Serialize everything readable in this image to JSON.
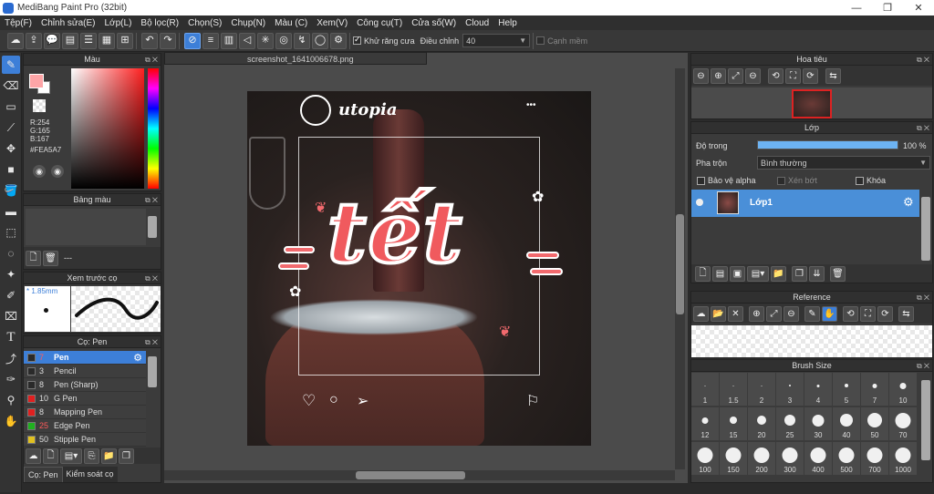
{
  "window": {
    "title": "MediBang Paint Pro (32bit)"
  },
  "menu": [
    "Tệp(F)",
    "Chỉnh sửa(E)",
    "Lớp(L)",
    "Bộ lọc(R)",
    "Chọn(S)",
    "Chụp(N)",
    "Màu (C)",
    "Xem(V)",
    "Công cụ(T)",
    "Cửa số(W)",
    "Cloud",
    "Help"
  ],
  "toolbar": {
    "antialias_label": "Khử răng cưa",
    "adjust_label": "Điều chỉnh",
    "adjust_value": "40",
    "smooth_label": "Cạnh mềm"
  },
  "color_panel": {
    "title": "Màu",
    "r": "R:254",
    "g": "G:165",
    "b": "B:167",
    "hex": "#FEA5A7",
    "current": "#fea5a7"
  },
  "palette_panel": {
    "title": "Bảng màu",
    "footer": "---"
  },
  "brush_preview": {
    "title": "Xem trước cọ",
    "size": "* 1.85mm"
  },
  "brush_panel": {
    "title": "Cọ: Pen",
    "items": [
      {
        "size": "7",
        "name": "Pen",
        "color": "#2a2a2a"
      },
      {
        "size": "3",
        "name": "Pencil",
        "color": "#2a2a2a"
      },
      {
        "size": "8",
        "name": "Pen (Sharp)",
        "color": "#2a2a2a"
      },
      {
        "size": "10",
        "name": "G Pen",
        "color": "#e02020"
      },
      {
        "size": "8",
        "name": "Mapping Pen",
        "color": "#e02020"
      },
      {
        "size": "25",
        "name": "Edge Pen",
        "color": "#20b020"
      },
      {
        "size": "50",
        "name": "Stipple Pen",
        "color": "#e0c020"
      }
    ],
    "tab1": "Cọ: Pen",
    "tab2": "Kiểm soát cọ"
  },
  "document": {
    "tab": "screenshot_1641006678.png"
  },
  "artwork": {
    "brand": "utopia",
    "word": "tết",
    "menu": "•••"
  },
  "navigator": {
    "title": "Hoa tiêu"
  },
  "layer_panel": {
    "title": "Lớp",
    "opacity_label": "Độ trong",
    "opacity_value": "100 %",
    "opacity_fraction": 1.0,
    "blend_label": "Pha trộn",
    "blend_value": "Bình thường",
    "protect_alpha": "Bảo vệ alpha",
    "clip": "Xén bớt",
    "lock": "Khóa",
    "layer_name": "Lớp1"
  },
  "reference": {
    "title": "Reference"
  },
  "brush_size": {
    "title": "Brush Size",
    "sizes": [
      "1",
      "1.5",
      "2",
      "3",
      "4",
      "5",
      "7",
      "10",
      "12",
      "15",
      "20",
      "25",
      "30",
      "40",
      "50",
      "70",
      "100",
      "150",
      "200",
      "300",
      "400",
      "500",
      "700",
      "1000"
    ]
  }
}
